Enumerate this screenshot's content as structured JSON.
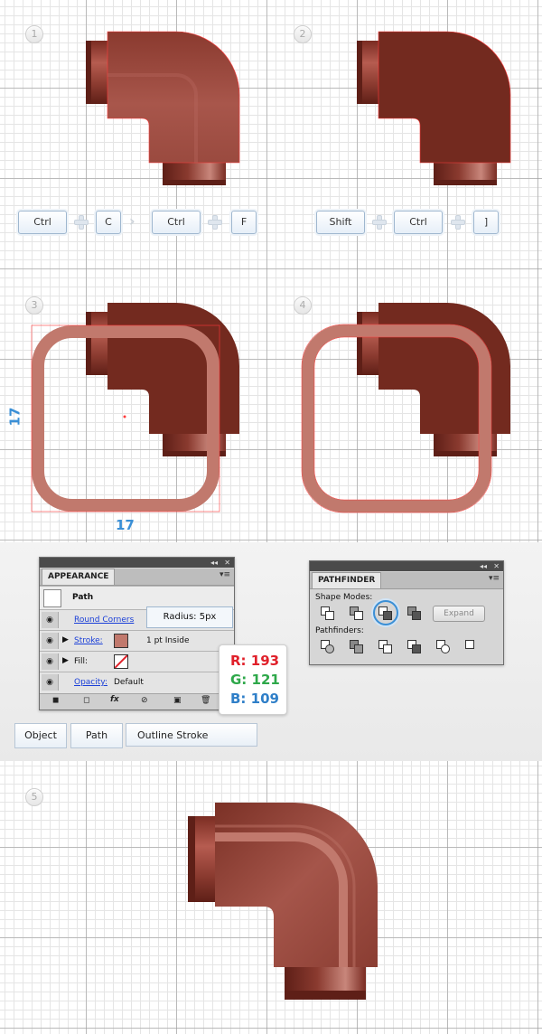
{
  "steps": {
    "s1": "1",
    "s2": "2",
    "s3": "3",
    "s4": "4",
    "s5": "5"
  },
  "keys_row1": {
    "k1": "Ctrl",
    "k2": "C",
    "k3": "Ctrl",
    "k4": "F"
  },
  "keys_row2": {
    "k1": "Shift",
    "k2": "Ctrl",
    "k3": "]"
  },
  "dimensions": {
    "height": "17",
    "width": "17"
  },
  "appearance_panel": {
    "title": "APPEARANCE",
    "object_type": "Path",
    "effect_label": "Round Corners",
    "radius_tooltip": "Radius: 5px",
    "stroke_label": "Stroke:",
    "stroke_value": "1 pt  Inside",
    "fill_label": "Fill:",
    "opacity_label": "Opacity:",
    "opacity_value": "Default",
    "stroke_color": "#c1796d"
  },
  "rgb_callout": {
    "r": "R: 193",
    "g": "G: 121",
    "b": "B: 109",
    "r_color": "#e0202a",
    "g_color": "#2ea84a",
    "b_color": "#2f7fc8"
  },
  "menu_path": {
    "m1": "Object",
    "m2": "Path",
    "m3": "Outline Stroke"
  },
  "pathfinder_panel": {
    "title": "PATHFINDER",
    "shape_modes_label": "Shape Modes:",
    "pathfinders_label": "Pathfinders:",
    "expand_label": "Expand"
  },
  "colors": {
    "pipe_dark": "#732a1f",
    "pipe_base": "#a5554a",
    "highlight": "#c1796d",
    "anchor": "#ff3b3b"
  }
}
